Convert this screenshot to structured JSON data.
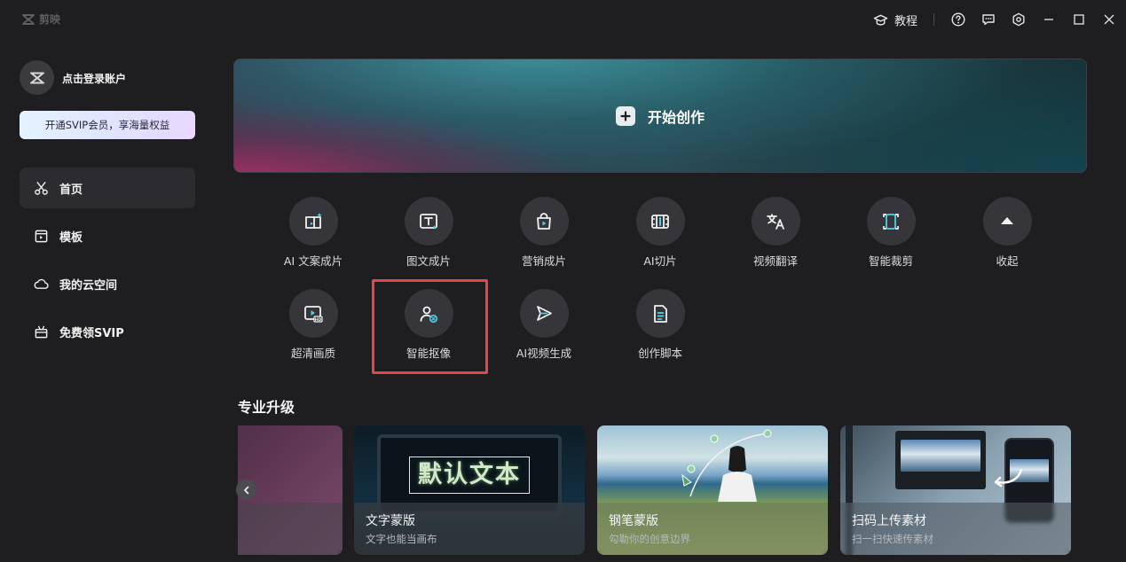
{
  "app": {
    "logo_text": "剪映"
  },
  "titlebar": {
    "tutorial_label": "教程"
  },
  "sidebar": {
    "login_text": "点击登录账户",
    "svip_banner": "开通SVIP会员，享海量权益",
    "items": [
      {
        "label": "首页",
        "icon": "scissors-icon",
        "active": true
      },
      {
        "label": "模板",
        "icon": "template-icon",
        "active": false
      },
      {
        "label": "我的云空间",
        "icon": "cloud-icon",
        "active": false
      },
      {
        "label": "免费领SVIP",
        "icon": "gift-icon",
        "active": false
      }
    ]
  },
  "hero": {
    "label": "开始创作"
  },
  "tools": [
    {
      "label": "AI 文案成片",
      "icon": "ai-script-video-icon"
    },
    {
      "label": "图文成片",
      "icon": "text-image-video-icon"
    },
    {
      "label": "营销成片",
      "icon": "shopping-bag-play-icon"
    },
    {
      "label": "AI切片",
      "icon": "ai-clip-icon"
    },
    {
      "label": "视频翻译",
      "icon": "translate-icon"
    },
    {
      "label": "智能裁剪",
      "icon": "smart-crop-icon"
    },
    {
      "label": "收起",
      "icon": "collapse-up-icon"
    },
    {
      "label": "超清画质",
      "icon": "hd-quality-icon"
    },
    {
      "label": "智能抠像",
      "icon": "person-cutout-icon"
    },
    {
      "label": "AI视频生成",
      "icon": "ai-video-generate-icon"
    },
    {
      "label": "创作脚本",
      "icon": "script-document-icon"
    }
  ],
  "section": {
    "title": "专业升级",
    "cards": [
      {
        "title": "",
        "subtitle": ""
      },
      {
        "title": "文字蒙版",
        "subtitle": "文字也能当画布",
        "preview_text": "默认文本"
      },
      {
        "title": "钢笔蒙版",
        "subtitle": "勾勒你的创意边界"
      },
      {
        "title": "扫码上传素材",
        "subtitle": "扫一扫快速传素材"
      }
    ]
  },
  "colors": {
    "background": "#1e1e21",
    "highlight": "#e0484b",
    "accent": "#e6e6e6"
  }
}
